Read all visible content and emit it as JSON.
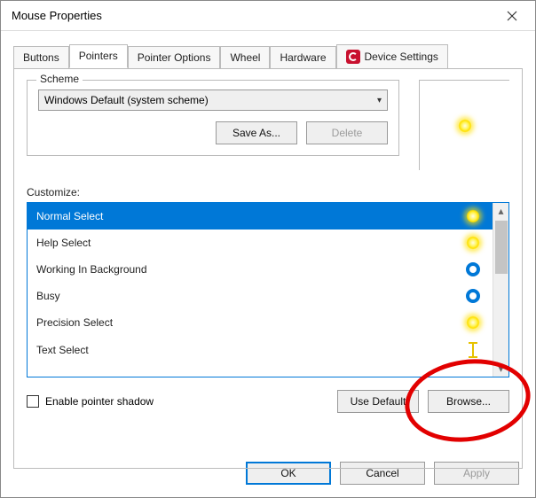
{
  "window": {
    "title": "Mouse Properties"
  },
  "tabs": {
    "buttons": "Buttons",
    "pointers": "Pointers",
    "pointer_options": "Pointer Options",
    "wheel": "Wheel",
    "hardware": "Hardware",
    "device_settings": "Device Settings"
  },
  "scheme": {
    "legend": "Scheme",
    "selected": "Windows Default (system scheme)",
    "save_as": "Save As...",
    "delete": "Delete"
  },
  "customize": {
    "label": "Customize:",
    "items": [
      {
        "label": "Normal Select",
        "icon": "yellow-dot",
        "selected": true
      },
      {
        "label": "Help Select",
        "icon": "yellow-dot",
        "selected": false
      },
      {
        "label": "Working In Background",
        "icon": "blue-ring",
        "selected": false
      },
      {
        "label": "Busy",
        "icon": "blue-ring",
        "selected": false
      },
      {
        "label": "Precision Select",
        "icon": "yellow-dot",
        "selected": false
      },
      {
        "label": "Text Select",
        "icon": "ibeam",
        "selected": false
      }
    ]
  },
  "enable_shadow": {
    "label": "Enable pointer shadow",
    "checked": false
  },
  "buttons": {
    "use_default": "Use Default",
    "browse": "Browse...",
    "ok": "OK",
    "cancel": "Cancel",
    "apply": "Apply"
  },
  "annotation": {
    "circle_target": "browse-button"
  }
}
